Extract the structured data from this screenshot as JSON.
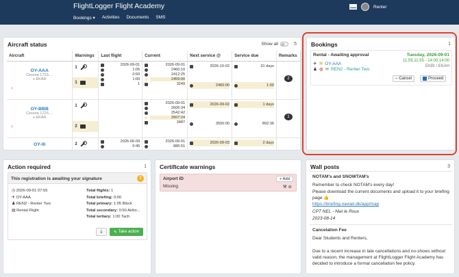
{
  "header": {
    "brand": "FlightLogger Flight Academy",
    "nav": [
      "Bookings",
      "Activities",
      "Documents",
      "SMS"
    ],
    "user": "Renter"
  },
  "aircraft_status": {
    "title": "Aircraft status",
    "show_all": "Show all",
    "count": "5",
    "columns": [
      "Aircraft",
      "Warnings",
      "Last flight",
      "Current",
      "Next service @",
      "Service due",
      "Remarks"
    ],
    "rows": [
      {
        "reg": "OY-AAA",
        "type": "Cessna 172S ...",
        "loc": "EKAH",
        "warnings": [
          "1",
          "1"
        ],
        "last_flight": [
          "2026-09-01",
          "1:05",
          "0:50",
          "1:00",
          "1"
        ],
        "current": [
          "2026-09-01",
          "2460:10",
          "2412:25",
          "2459:00",
          "3249"
        ],
        "next_service": [
          "2026-10-02",
          "2460:00"
        ],
        "service_due": [
          "31 days",
          "1:00"
        ],
        "remarks": "2"
      },
      {
        "reg": "OY-BBB",
        "type": "Cessna 172S ...",
        "loc": "EKAH",
        "warnings": [
          "1",
          "2"
        ],
        "last_flight": [],
        "current": [
          "2026-09-01",
          "2606:34",
          "2542:42",
          "2607:24",
          "3487"
        ],
        "next_service": [
          "2026-09-02",
          "3500:00"
        ],
        "service_due": [
          "1 days",
          "892:36"
        ],
        "remarks": "1"
      },
      {
        "reg": "OY-III",
        "type": "",
        "loc": "",
        "warnings": [
          "2"
        ],
        "last_flight": [
          "2026-06-09",
          "0:45"
        ],
        "current": [
          "2026-09-01",
          "886:51"
        ],
        "next_service": [
          "2026-09-03"
        ],
        "service_due": [
          "2 days"
        ],
        "remarks": ""
      }
    ]
  },
  "bookings": {
    "title": "Bookings",
    "count": "1",
    "item": {
      "title": "Rental - Awaiting approval",
      "date": "Tuesday, 2026-09-01",
      "time": "11:55,11:55 - 14:00,14:00",
      "route": "EKBI / EKAH",
      "aircraft": "OY-AAA",
      "person": "REN2 - Renter Two",
      "cancel": "Cancel",
      "proceed": "Proceed"
    }
  },
  "action_required": {
    "title": "Action required",
    "count": "1",
    "card_title": "This registration is awaiting your signature",
    "left": [
      "2026-09-01 07:55",
      "OY-AAA",
      "REN2 - Renter Two",
      "Rental Flight"
    ],
    "right_labels": [
      "Total flights:",
      "Total briefing:",
      "Total primary:",
      "Total secondary:",
      "Total tertiary:"
    ],
    "right_values": [
      "1",
      "0:00",
      "1:05 Block",
      "0:50 Airbo...",
      "1:00 Tach"
    ],
    "take_action": "Take action"
  },
  "certificate_warnings": {
    "title": "Certificate warnings",
    "airport": "Airport ID",
    "status": "Missing",
    "add": "Add"
  },
  "wall_posts": {
    "title": "Wall posts",
    "count": "3",
    "post1": {
      "title": "NOTAM's and SNOWTAM's",
      "body1": "Remember to check NOTAM's every day!",
      "body2": "Please download the current documents and upload it to your briefing page 👍",
      "link": "https://briefing.naviair.dk/app/map",
      "by": "CPT NEL - Niel le Roux",
      "date": "2023-08-14"
    },
    "post2": {
      "title": "Cancelation Fee",
      "greet": "Dear Students and Renters,",
      "body": "Due to a recent increase in late cancellations and no-shows without valid reason, the management at FlightLogger Flight Academy has decided to introduce a formal cancellation fee policy."
    }
  }
}
